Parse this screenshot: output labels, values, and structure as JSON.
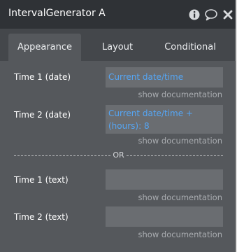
{
  "window": {
    "title": "IntervalGenerator A"
  },
  "tabs": [
    {
      "label": "Appearance",
      "active": true
    },
    {
      "label": "Layout",
      "active": false
    },
    {
      "label": "Conditional",
      "active": false
    }
  ],
  "fields": {
    "time1_date": {
      "label": "Time 1 (date)",
      "value": "Current date/time",
      "doc_link": "show documentation"
    },
    "time2_date": {
      "label": "Time 2 (date)",
      "value": "Current date/time +(hours): 8",
      "doc_link": "show documentation"
    },
    "time1_text": {
      "label": "Time 1 (text)",
      "value": "",
      "doc_link": "show documentation"
    },
    "time2_text": {
      "label": "Time 2 (text)",
      "value": "",
      "doc_link": "show documentation"
    }
  },
  "divider": {
    "label": "OR"
  },
  "icons": [
    "info-icon",
    "comment-icon",
    "close-icon"
  ],
  "colors": {
    "panel": "#55585c",
    "titlebar": "#2f3236",
    "tabs_bg": "#44474b",
    "field_bg": "#6a6d71",
    "dynamic_value": "#55a6f5",
    "doc_link": "#a9acb0"
  }
}
